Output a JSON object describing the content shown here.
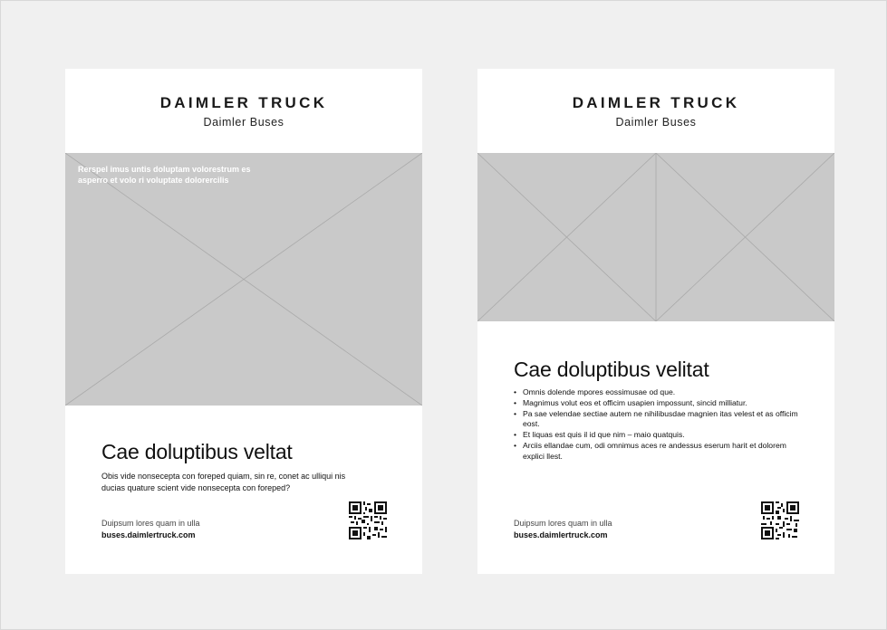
{
  "posters": [
    {
      "brand": "DAIMLER TRUCK",
      "subbrand": "Daimler Buses",
      "image_caption": "Rerspel imus untis doluptam volorestrum es asperro et volo ri voluptate dolorercilis",
      "headline": "Cae doluptibus veltat",
      "body": "Obis vide nonsecepta con foreped quiam, sin re, conet ac ulliqui nis ducias quature scient vide nonsecepta con foreped?",
      "footer_line": "Duipsum lores quam in ulla",
      "footer_url": "buses.daimlertruck.com"
    },
    {
      "brand": "DAIMLER TRUCK",
      "subbrand": "Daimler Buses",
      "headline": "Cae doluptibus velitat",
      "bullets": [
        "Omnis dolende mpores eossimusae od que.",
        "Magnimus volut eos et officim usapien impossunt, sincid milliatur.",
        "Pa sae velendae sectiae autem ne nihilibusdae magnien itas velest et as officim eost.",
        "Et liquas est quis il id que nim – maio quatquis.",
        "Arciis ellandae cum, odi omnimus aces re andessus eserum harit et dolorem explici llest."
      ],
      "footer_line": "Duipsum lores quam in ulla",
      "footer_url": "buses.daimlertruck.com"
    }
  ],
  "colors": {
    "background": "#efefef",
    "placeholder": "#c9c9c9",
    "placeholder_lines": "#a9a9a9"
  },
  "icons": [
    "qr-code-icon"
  ]
}
